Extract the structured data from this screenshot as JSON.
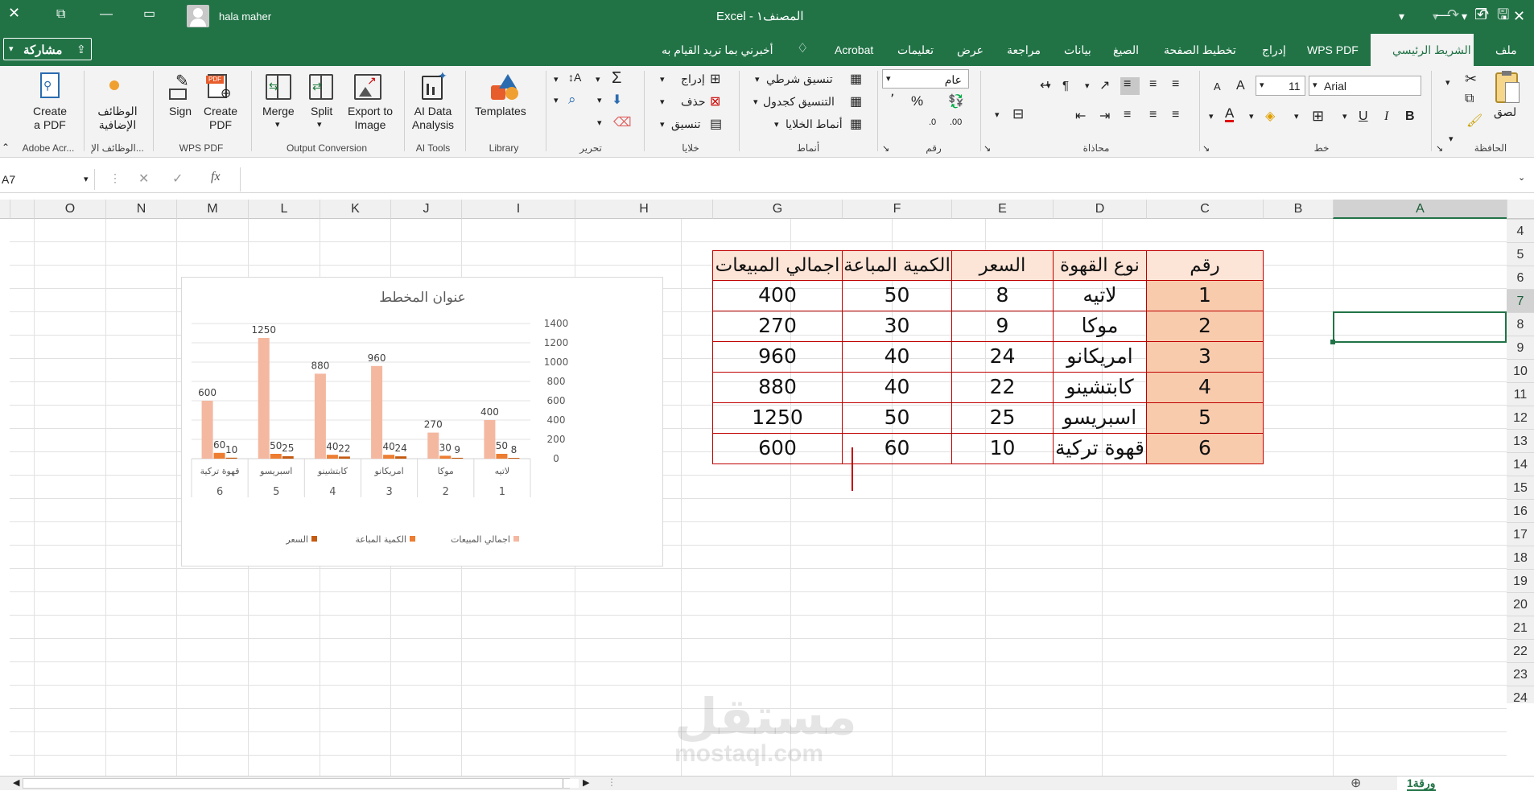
{
  "titlebar": {
    "user": "hala maher",
    "doc_title": "Excel  -  المصنف١"
  },
  "tabs": [
    "ملف",
    "الشريط الرئيسي",
    "WPS PDF",
    "إدراج",
    "تخطيط الصفحة",
    "الصيغ",
    "بيانات",
    "مراجعة",
    "عرض",
    "تعليمات",
    "Acrobat",
    "أخبرني بما تريد القيام به"
  ],
  "share_label": "مشاركة",
  "ribbon": {
    "clipboard": {
      "label": "الحافظة",
      "paste": "لصق"
    },
    "font": {
      "label": "خط",
      "name": "Arial",
      "size": "11",
      "bold": "B",
      "italic": "I",
      "underline": "U"
    },
    "alignment": {
      "label": "محاذاة"
    },
    "number": {
      "label": "رقم",
      "format": "عام",
      "percent": "%",
      "comma": "٬"
    },
    "styles": {
      "label": "أنماط",
      "conditional": "تنسيق شرطي",
      "as_table": "التنسيق كجدول",
      "cell_styles": "أنماط الخلايا"
    },
    "cells": {
      "label": "خلايا",
      "insert": "إدراج",
      "delete": "حذف",
      "format": "تنسيق"
    },
    "editing": {
      "label": "تحرير"
    },
    "library": {
      "label": "Library",
      "templates": "Templates"
    },
    "ai_tools": {
      "label": "AI Tools",
      "ai_data": "AI Data Analysis"
    },
    "output": {
      "label": "Output Conversion",
      "merge": "Merge",
      "split": "Split",
      "export": "Export to Image"
    },
    "wps_pdf": {
      "label": "WPS PDF",
      "sign": "Sign",
      "create": "Create PDF"
    },
    "addins": {
      "label": "الوظائف الإ...",
      "btn": "الوظائف الإضافية"
    },
    "adobe": {
      "label": "Adobe Acr...",
      "create": "Create a PDF"
    }
  },
  "formula_bar": {
    "name_box": "A7",
    "fx": "fx",
    "value": ""
  },
  "columns": [
    "A",
    "B",
    "C",
    "D",
    "E",
    "F",
    "G",
    "H",
    "I",
    "J",
    "K",
    "L",
    "M",
    "N",
    "O"
  ],
  "rows": [
    "4",
    "5",
    "6",
    "7",
    "8",
    "9",
    "10",
    "11",
    "12",
    "13",
    "14",
    "15",
    "16",
    "17",
    "18",
    "19",
    "20",
    "21",
    "22",
    "23",
    "24"
  ],
  "table": {
    "headers": [
      "رقم",
      "نوع القهوة",
      "السعر",
      "الكمية المباعة",
      "اجمالي المبيعات"
    ],
    "rows": [
      [
        "1",
        "لاتيه",
        "8",
        "50",
        "400"
      ],
      [
        "2",
        "موكا",
        "9",
        "30",
        "270"
      ],
      [
        "3",
        "امريكانو",
        "24",
        "40",
        "960"
      ],
      [
        "4",
        "كابتشينو",
        "22",
        "40",
        "880"
      ],
      [
        "5",
        "اسبريسو",
        "25",
        "50",
        "1250"
      ],
      [
        "6",
        "قهوة تركية",
        "10",
        "60",
        "600"
      ]
    ]
  },
  "chart_data": {
    "type": "bar",
    "title": "عنوان المخطط",
    "categories": [
      "لاتيه",
      "موكا",
      "امريكانو",
      "كابتشينو",
      "اسبريسو",
      "قهوة تركية"
    ],
    "numbers": [
      "1",
      "2",
      "3",
      "4",
      "5",
      "6"
    ],
    "series": [
      {
        "name": "اجمالي المبيعات",
        "values": [
          400,
          270,
          960,
          880,
          1250,
          600
        ],
        "color": "#f4b8a0"
      },
      {
        "name": "الكمية المباعة",
        "values": [
          50,
          30,
          40,
          40,
          50,
          60
        ],
        "color": "#ed7d31"
      },
      {
        "name": "السعر",
        "values": [
          8,
          9,
          24,
          22,
          25,
          10
        ],
        "color": "#c55a11"
      }
    ],
    "ylim": [
      0,
      1400
    ],
    "yticks": [
      "0",
      "200",
      "400",
      "600",
      "800",
      "1000",
      "1200",
      "1400"
    ],
    "grid": true,
    "legend": "bottom",
    "x_direction": "right-to-left",
    "y_axis_side": "right"
  },
  "sheet_tab": "ورقة1",
  "watermark": {
    "arabic": "مستقل",
    "latin": "mostaql.com"
  },
  "colors": {
    "excel_green": "#217346",
    "header_fill": "#fce4d6",
    "number_fill": "#f8cbad",
    "border": "#c00000"
  }
}
